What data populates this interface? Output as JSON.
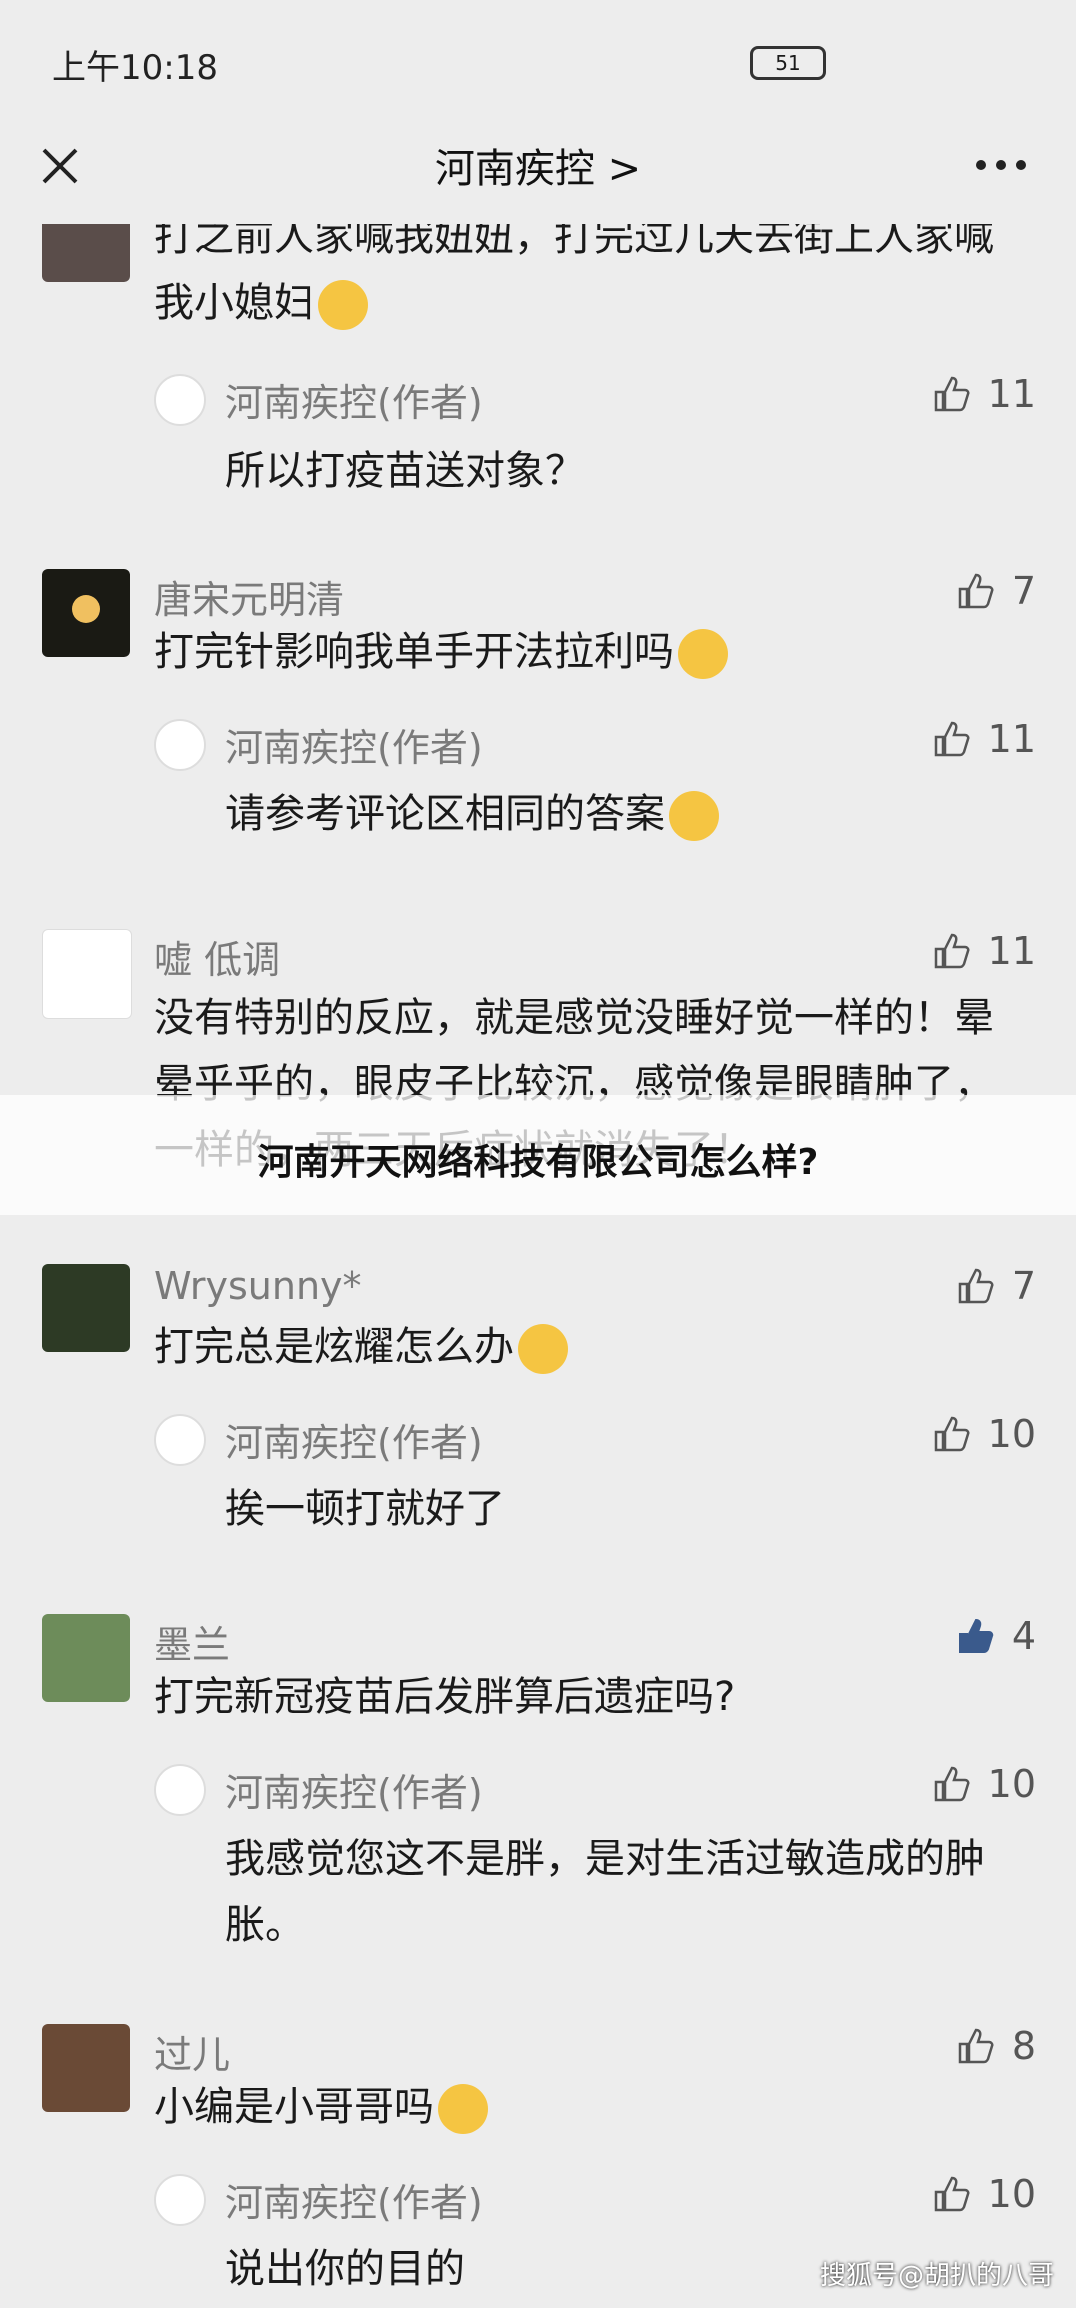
{
  "status_bar": {
    "time": "上午10:18",
    "battery": "51"
  },
  "nav": {
    "title": "河南疾控 >"
  },
  "comments": [
    {
      "name": "",
      "text": "打之前人家喊我妞妞，打完过几天去街上人家喊我小媳妇",
      "likes": "",
      "reply": {
        "name": "河南疾控(作者)",
        "text": "所以打疫苗送对象？",
        "likes": "11"
      }
    },
    {
      "name": "唐宋元明清",
      "text": "打完针影响我单手开法拉利吗",
      "likes": "7",
      "reply": {
        "name": "河南疾控(作者)",
        "text": "请参考评论区相同的答案",
        "likes": "11"
      }
    },
    {
      "name": "嘘 低调",
      "text": "没有特别的反应，就是感觉没睡好觉一样的！晕晕乎乎的，眼皮子比较沉，感觉像是眼睛肿了，一样的，两三天后症状就消失了！",
      "likes": "11"
    },
    {
      "name": "Wrysunny*",
      "text": "打完总是炫耀怎么办",
      "likes": "7",
      "reply": {
        "name": "河南疾控(作者)",
        "text": "挨一顿打就好了",
        "likes": "10"
      }
    },
    {
      "name": "墨兰",
      "text": "打完新冠疫苗后发胖算后遗症吗?",
      "likes": "4",
      "reply": {
        "name": "河南疾控(作者)",
        "text": "我感觉您这不是胖，是对生活过敏造成的肿胀。",
        "likes": "10"
      }
    },
    {
      "name": "过儿",
      "text": "小编是小哥哥吗",
      "likes": "8",
      "reply": {
        "name": "河南疾控(作者)",
        "text": "说出你的目的",
        "likes": "10"
      }
    }
  ],
  "overlay": {
    "text": "河南开天网络科技有限公司怎么样?"
  },
  "watermark": {
    "text": "搜狐号@胡扒的八哥"
  },
  "colors": {
    "background": "#ededed",
    "name_gray": "#7a7a7a",
    "accent": "#3a5a8c"
  }
}
